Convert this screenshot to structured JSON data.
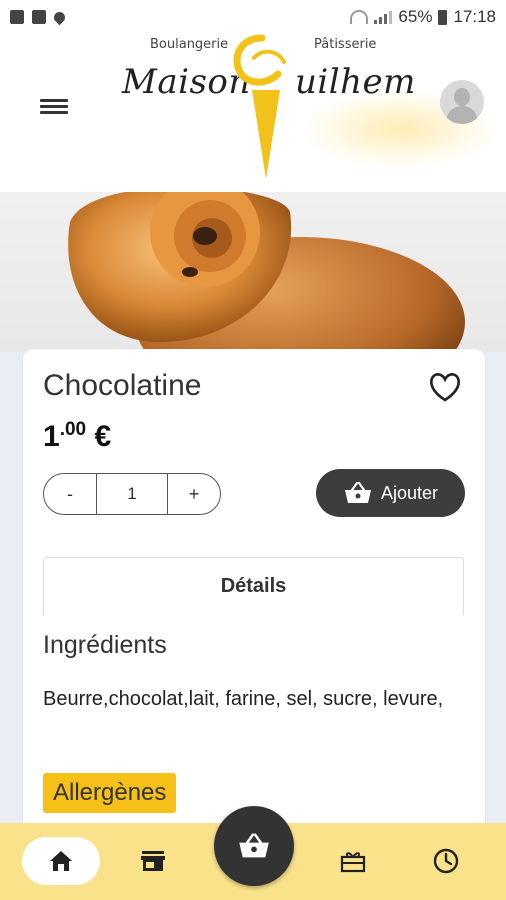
{
  "status_bar": {
    "battery": "65%",
    "time": "17:18"
  },
  "brand": {
    "left_small": "Boulangerie",
    "right_small": "Pâtisserie",
    "name_left": "Maison",
    "name_right": "uilhem"
  },
  "product": {
    "name": "Chocolatine",
    "price_int": "1",
    "price_dec": ".00",
    "price_cur": "€",
    "quantity": "1"
  },
  "actions": {
    "minus": "-",
    "plus": "+",
    "add_to_cart": "Ajouter"
  },
  "tabs": {
    "details": "Détails"
  },
  "ingredients": {
    "title": "Ingrédients",
    "text": "Beurre,chocolat,lait, farine, sel, sucre, levure,"
  },
  "allergens": {
    "label": "Allergènes"
  },
  "colors": {
    "brand_yellow": "#f6c018",
    "nav_bg": "#fae28b",
    "dark": "#3d3d3d"
  }
}
